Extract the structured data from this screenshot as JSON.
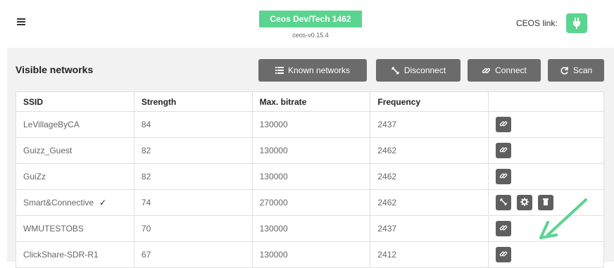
{
  "header": {
    "brand": "Ceos Dev/Tech 1462",
    "version": "ceos-v0.15.4",
    "ceos_link_label": "CEOS link:",
    "accent_color": "#5bd48f"
  },
  "panel": {
    "title": "Visible networks",
    "buttons": {
      "known": "Known networks",
      "disconnect": "Disconnect",
      "connect": "Connect",
      "scan": "Scan"
    }
  },
  "table": {
    "headers": [
      "SSID",
      "Strength",
      "Max. bitrate",
      "Frequency"
    ],
    "rows": [
      {
        "ssid": "LeVillageByCA",
        "strength": "84",
        "bitrate": "130000",
        "freq": "2437",
        "connected": false
      },
      {
        "ssid": "Guizz_Guest",
        "strength": "82",
        "bitrate": "130000",
        "freq": "2462",
        "connected": false
      },
      {
        "ssid": "GuiZz",
        "strength": "82",
        "bitrate": "130000",
        "freq": "2462",
        "connected": false
      },
      {
        "ssid": "Smart&Connective",
        "strength": "74",
        "bitrate": "270000",
        "freq": "2462",
        "connected": true
      },
      {
        "ssid": "WMUTESTOBS",
        "strength": "70",
        "bitrate": "130000",
        "freq": "2437",
        "connected": false
      },
      {
        "ssid": "ClickShare-SDR-R1",
        "strength": "67",
        "bitrate": "130000",
        "freq": "2412",
        "connected": false
      }
    ]
  },
  "icons": {
    "menu": "hamburger-icon",
    "ceos_link": "plug-icon",
    "known": "list-icon",
    "disconnect": "unlink-icon",
    "connect": "link-icon",
    "scan": "refresh-icon",
    "row_connect": "link-icon",
    "row_disconnect": "unlink-icon",
    "row_settings": "gear-icon",
    "row_delete": "trash-icon",
    "annotation": "green-arrow"
  }
}
